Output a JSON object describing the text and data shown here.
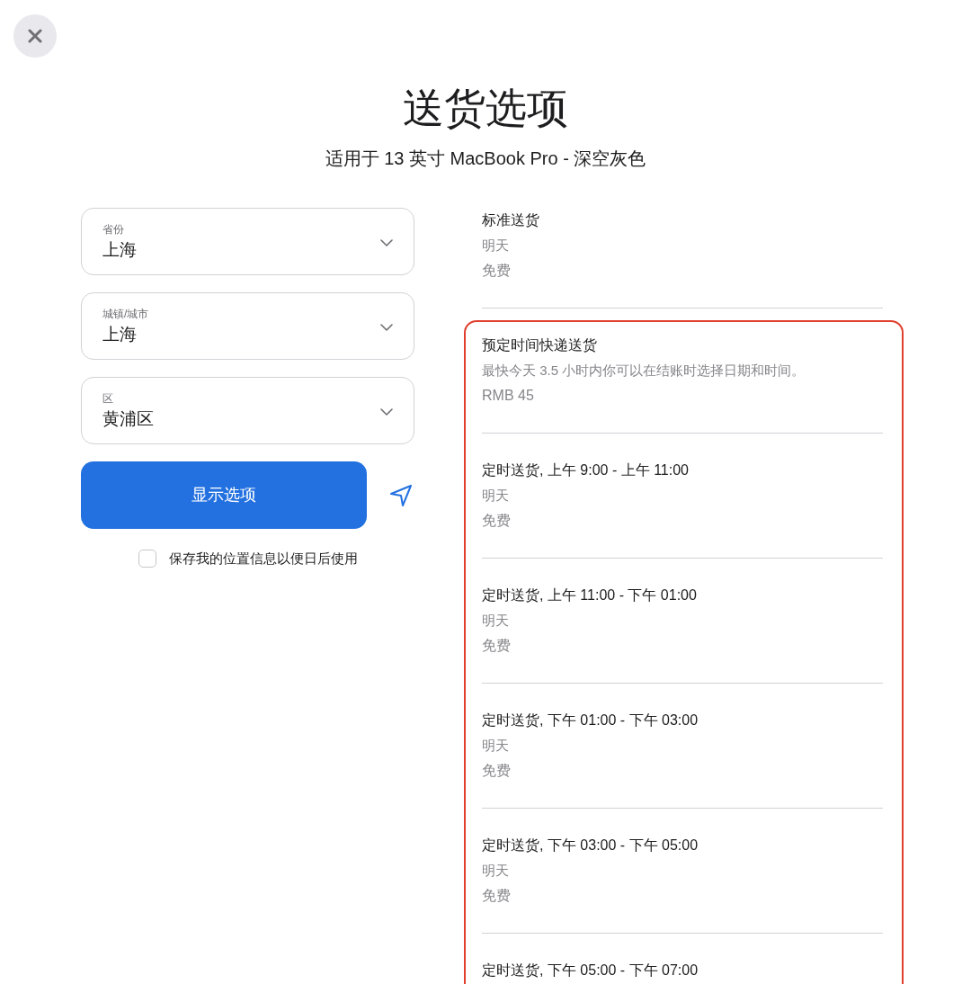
{
  "title": "送货选项",
  "subtitle": "适用于 13 英寸 MacBook Pro - 深空灰色",
  "location_fields": [
    {
      "label": "省份",
      "value": "上海"
    },
    {
      "label": "城镇/城市",
      "value": "上海"
    },
    {
      "label": "区",
      "value": "黄浦区"
    }
  ],
  "show_options_button": "显示选项",
  "save_location": {
    "label": "保存我的位置信息以便日后使用",
    "checked": false
  },
  "delivery_options": [
    {
      "title": "标准送货",
      "detail": "明天",
      "price": "免费",
      "highlighted": false
    },
    {
      "title": "预定时间快递送货",
      "detail": "最快今天 3.5 小时内你可以在结账时选择日期和时间。",
      "price": "RMB 45",
      "highlighted": true
    },
    {
      "title": "定时送货, 上午 9:00 - 上午 11:00",
      "detail": "明天",
      "price": "免费",
      "highlighted": true
    },
    {
      "title": "定时送货, 上午 11:00 - 下午 01:00",
      "detail": "明天",
      "price": "免费",
      "highlighted": true
    },
    {
      "title": "定时送货, 下午 01:00 - 下午 03:00",
      "detail": "明天",
      "price": "免费",
      "highlighted": true
    },
    {
      "title": "定时送货, 下午 03:00 - 下午 05:00",
      "detail": "明天",
      "price": "免费",
      "highlighted": true
    },
    {
      "title": "定时送货, 下午 05:00 - 下午 07:00",
      "highlighted": true
    }
  ]
}
